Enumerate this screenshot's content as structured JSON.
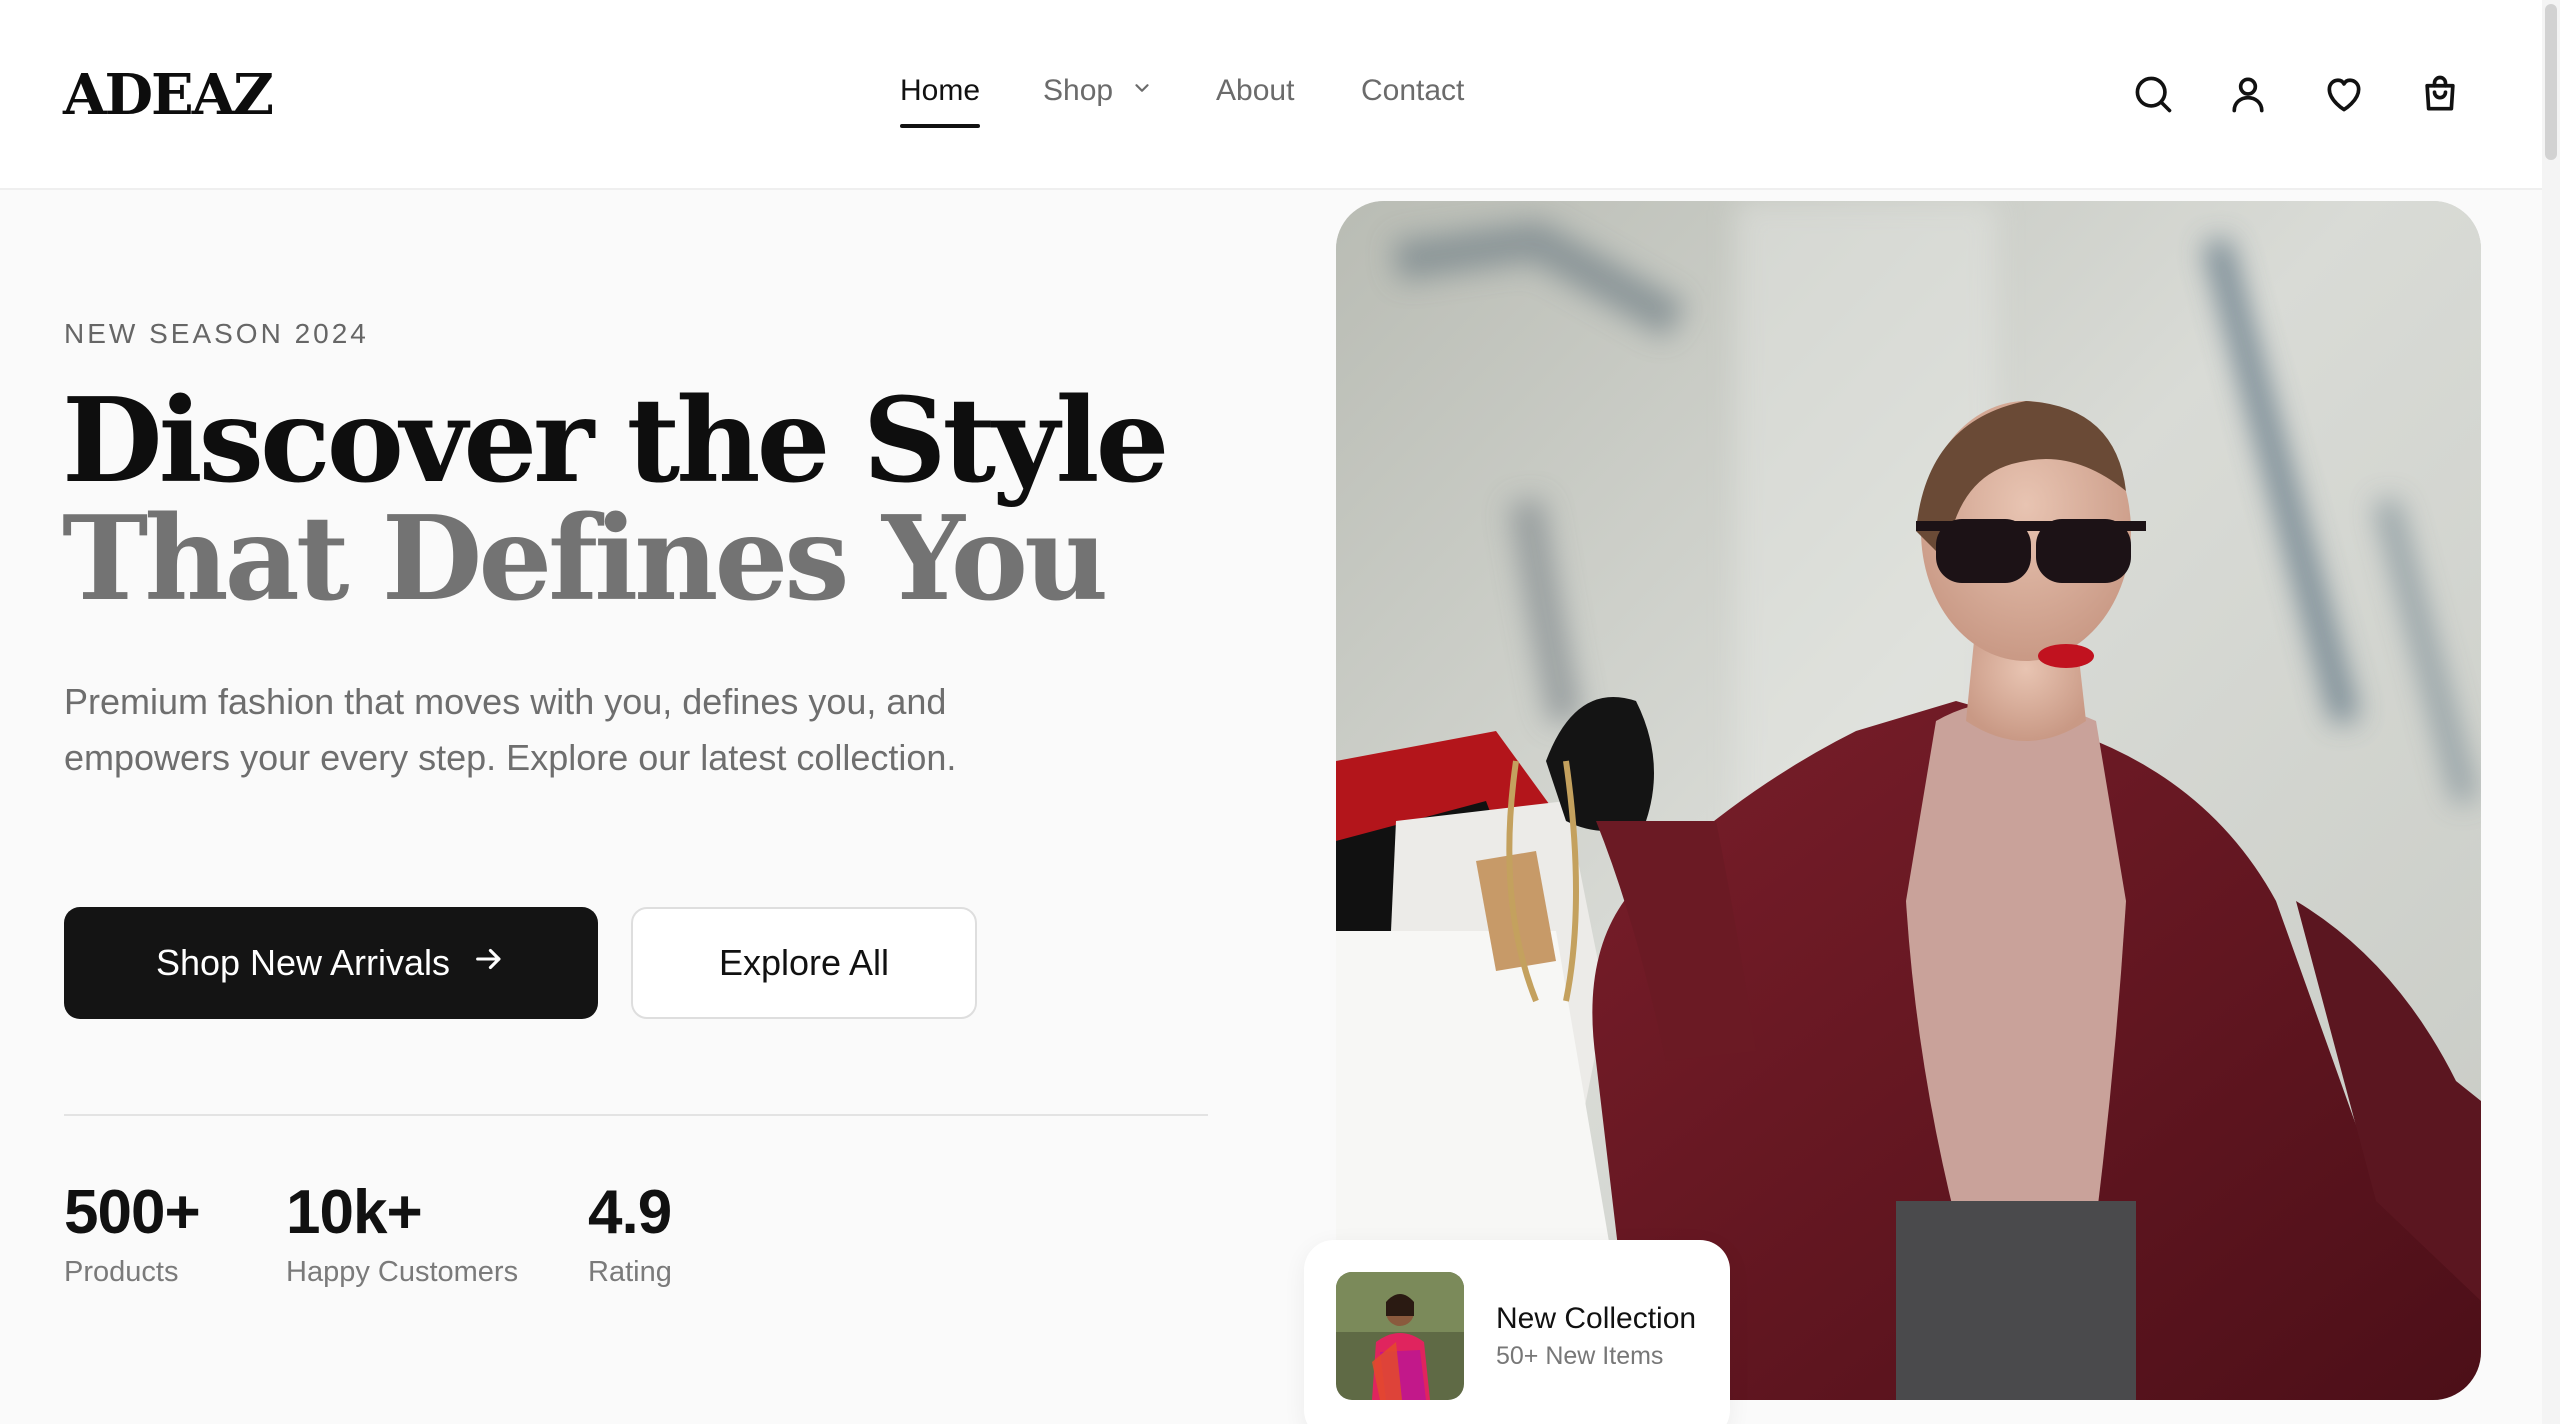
{
  "brand": {
    "logo": "ADEAZ"
  },
  "nav": {
    "items": [
      {
        "label": "Home",
        "active": true
      },
      {
        "label": "Shop",
        "active": false,
        "has_dropdown": true
      },
      {
        "label": "About",
        "active": false
      },
      {
        "label": "Contact",
        "active": false
      }
    ]
  },
  "header_icons": [
    "search-icon",
    "user-icon",
    "heart-icon",
    "shopping-bag-icon"
  ],
  "hero": {
    "eyebrow": "NEW SEASON 2024",
    "headline_line1": "Discover the Style",
    "headline_line2": "That Defines You",
    "description": "Premium fashion that moves with you, defines you, and empowers your every step. Explore our latest collection.",
    "primary_button": "Shop New Arrivals",
    "secondary_button": "Explore All"
  },
  "stats": [
    {
      "value": "500+",
      "label": "Products"
    },
    {
      "value": "10k+",
      "label": "Happy Customers"
    },
    {
      "value": "4.9",
      "label": "Rating"
    }
  ],
  "collection_card": {
    "title": "New Collection",
    "subtitle": "50+ New Items"
  },
  "colors": {
    "primary_button_bg": "#141414",
    "headline_dark": "#0e0e0e",
    "headline_muted": "#737373",
    "coat": "#6b1a24"
  }
}
